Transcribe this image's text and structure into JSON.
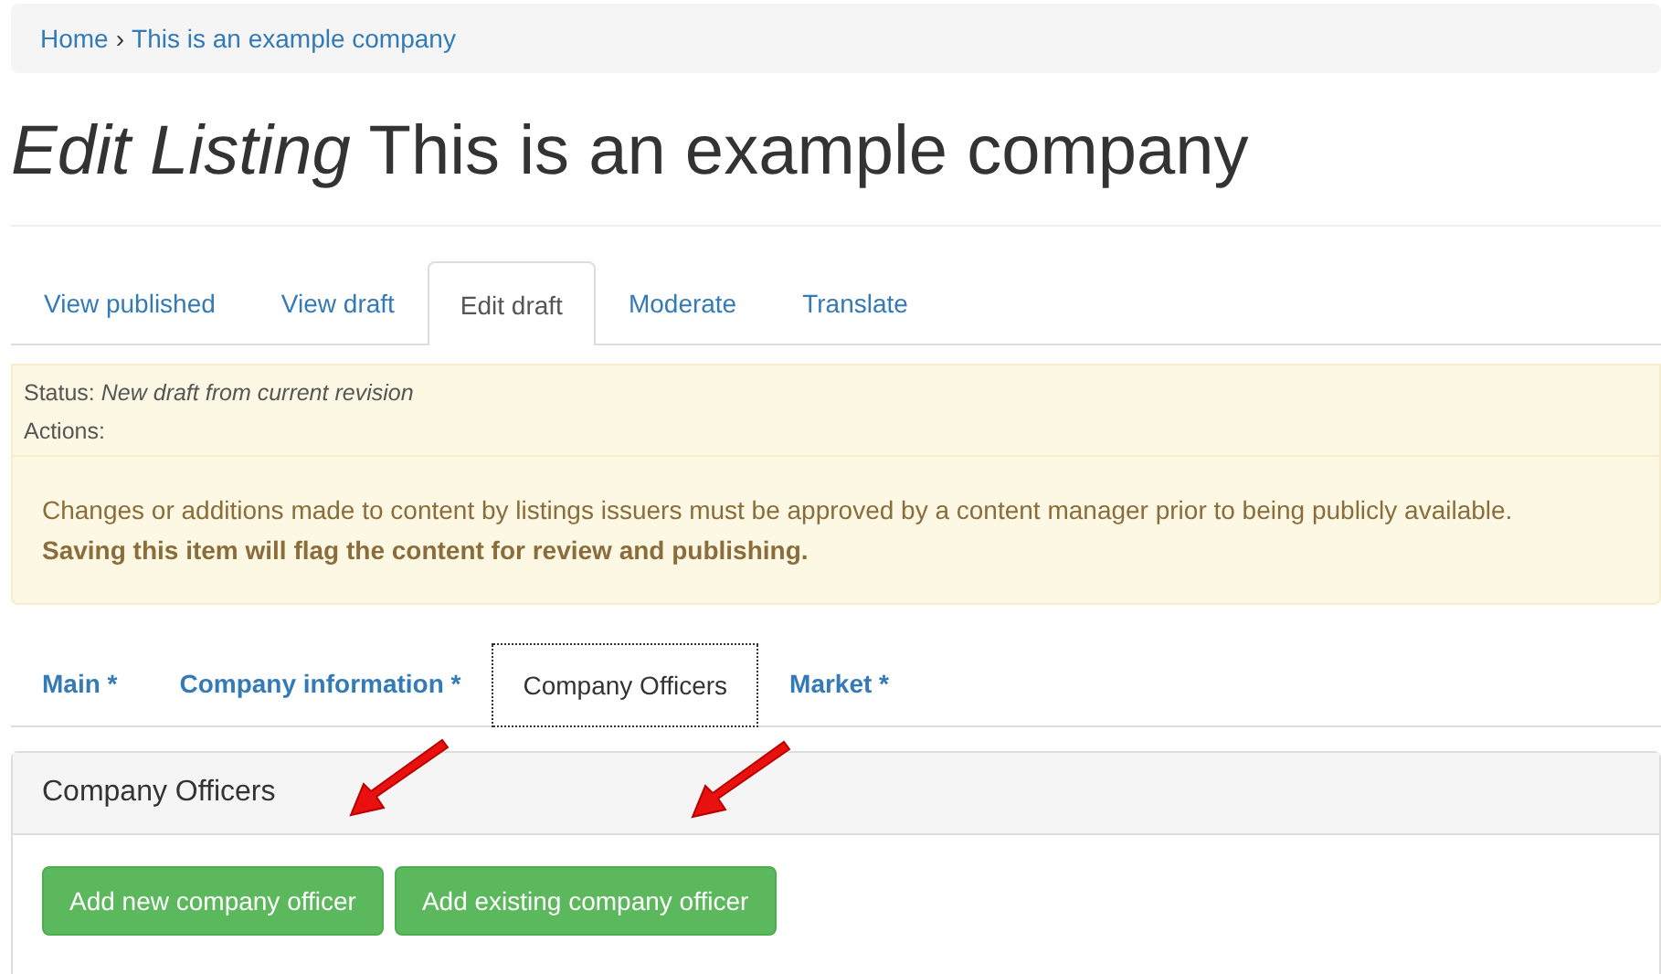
{
  "breadcrumb": [
    {
      "label": "Home"
    },
    {
      "label": "This is an example company"
    }
  ],
  "breadcrumb_separator": "›",
  "title": "*Edit Listing* This is an example company",
  "tabs": [
    {
      "label": "View published",
      "selected": false
    },
    {
      "label": "View draft",
      "selected": false
    },
    {
      "label": "Edit draft",
      "selected": true
    },
    {
      "label": "Moderate",
      "selected": false
    },
    {
      "label": "Translate",
      "selected": false
    }
  ],
  "status": {
    "status_line": "Status: *New draft from current revision*",
    "actions_label": "Actions:"
  },
  "notice": {
    "text": "Changes or additions made to content by listings issuers must be approved by a content manager prior to being publicly available.",
    "emphasis": "Saving this item will flag the content for review and publishing."
  },
  "form_tabs": [
    {
      "label": "Main *",
      "selected": false
    },
    {
      "label": "Company information *",
      "selected": false
    },
    {
      "label": "Company Officers",
      "selected": true
    },
    {
      "label": "Market *",
      "selected": false
    }
  ],
  "panel": {
    "heading": "Company Officers",
    "buttons": [
      {
        "label": "Add new company officer"
      },
      {
        "label": "Add existing company officer"
      }
    ]
  }
}
